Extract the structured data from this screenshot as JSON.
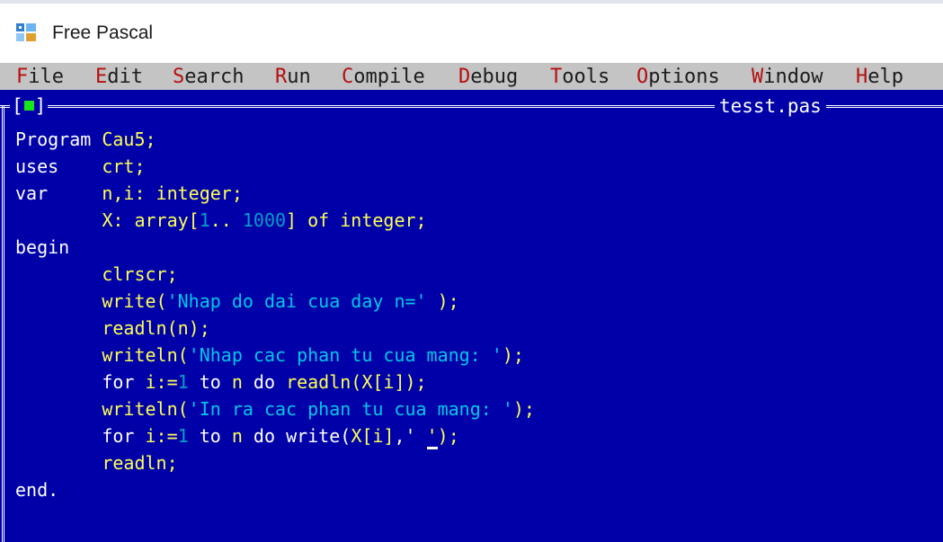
{
  "window": {
    "title": "Free Pascal",
    "icon": "free-pascal-app-icon"
  },
  "menu": [
    {
      "label": "File",
      "hotkey": "F",
      "rest": "ile"
    },
    {
      "label": "Edit",
      "hotkey": "E",
      "rest": "dit"
    },
    {
      "label": "Search",
      "hotkey": "S",
      "rest": "earch"
    },
    {
      "label": "Run",
      "hotkey": "R",
      "rest": "un"
    },
    {
      "label": "Compile",
      "hotkey": "C",
      "rest": "ompile"
    },
    {
      "label": "Debug",
      "hotkey": "D",
      "rest": "ebug"
    },
    {
      "label": "Tools",
      "hotkey": "T",
      "rest": "ools"
    },
    {
      "label": "Options",
      "hotkey": "O",
      "rest": "ptions"
    },
    {
      "label": "Window",
      "hotkey": "W",
      "rest": "indow"
    },
    {
      "label": "Help",
      "hotkey": "H",
      "rest": "elp"
    }
  ],
  "editor": {
    "close_box": {
      "left": "[",
      "right": "]"
    },
    "filename": "tesst.pas",
    "lines": [
      [
        [
          "kw",
          "Program "
        ],
        [
          "id",
          "Cau5"
        ],
        [
          "sym",
          ";"
        ]
      ],
      [
        [
          "kw",
          "uses    "
        ],
        [
          "id",
          "crt"
        ],
        [
          "sym",
          ";"
        ]
      ],
      [
        [
          "kw",
          "var     "
        ],
        [
          "id",
          "n,i: integer;"
        ]
      ],
      [
        [
          "kw",
          "        "
        ],
        [
          "id",
          "X: array["
        ],
        [
          "num",
          "1"
        ],
        [
          "id",
          ".. "
        ],
        [
          "num",
          "1000"
        ],
        [
          "id",
          "] of integer;"
        ]
      ],
      [
        [
          "kw",
          "begin"
        ]
      ],
      [
        [
          "kw",
          "        "
        ],
        [
          "id",
          "clrscr;"
        ]
      ],
      [
        [
          "kw",
          "        "
        ],
        [
          "id",
          "write("
        ],
        [
          "str",
          "'Nhap do dai cua day n='"
        ],
        [
          "id",
          " );"
        ]
      ],
      [
        [
          "kw",
          "        "
        ],
        [
          "id",
          "readln(n);"
        ]
      ],
      [
        [
          "kw",
          "        "
        ],
        [
          "id",
          "writeln("
        ],
        [
          "str",
          "'Nhap cac phan tu cua mang: '"
        ],
        [
          "id",
          ");"
        ]
      ],
      [
        [
          "kw",
          "        "
        ],
        [
          "kw",
          "for "
        ],
        [
          "id",
          "i:="
        ],
        [
          "num",
          "1"
        ],
        [
          "kw",
          " to "
        ],
        [
          "id",
          "n"
        ],
        [
          "kw",
          " do "
        ],
        [
          "id",
          "readln(X[i]);"
        ]
      ],
      [
        [
          "kw",
          "        "
        ],
        [
          "id",
          "writeln("
        ],
        [
          "str",
          "'In ra cac phan tu cua mang: '"
        ],
        [
          "id",
          ");"
        ]
      ],
      [
        [
          "kw",
          "        "
        ],
        [
          "kw",
          "for "
        ],
        [
          "id",
          "i:="
        ],
        [
          "num",
          "1"
        ],
        [
          "kw",
          " to "
        ],
        [
          "id",
          "n"
        ],
        [
          "kw",
          " do "
        ],
        [
          "kw",
          "write("
        ],
        [
          "id",
          "X[i]"
        ],
        [
          "kw",
          ",' "
        ],
        [
          "cursor",
          "'"
        ],
        [
          "id",
          ");"
        ]
      ],
      [
        [
          "kw",
          "        "
        ],
        [
          "id",
          "readln;"
        ]
      ],
      [
        [
          "kw",
          "end."
        ]
      ]
    ]
  },
  "colors": {
    "editor_background": "#0000a8",
    "menubar_background": "#c4c4c4",
    "menu_hotkey": "#b41010",
    "identifier": "#ffff55",
    "string": "#00c8e6",
    "number": "#00a0c8",
    "close_box_square": "#17e617"
  }
}
